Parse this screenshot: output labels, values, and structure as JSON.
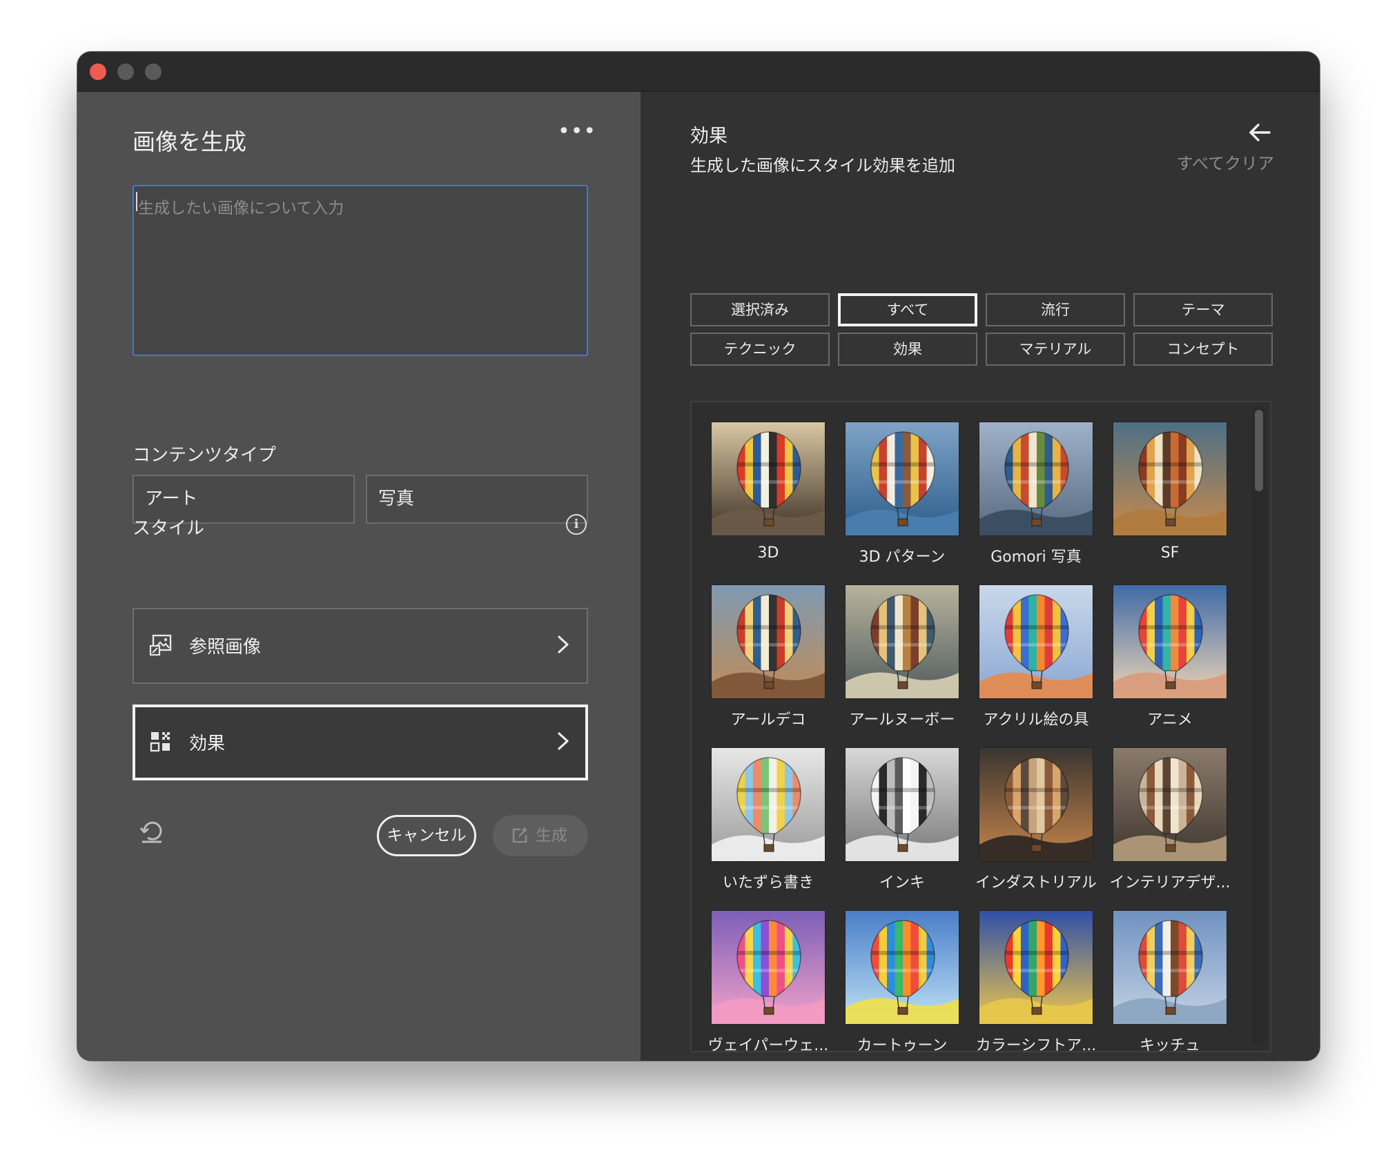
{
  "left": {
    "title": "画像を生成",
    "more_label": "•••",
    "prompt_placeholder": "生成したい画像について入力",
    "content_type_label": "コンテンツタイプ",
    "content_types": [
      "アート",
      "写真"
    ],
    "style_label": "スタイル",
    "info_label": "i",
    "reference_image_label": "参照画像",
    "effects_label": "効果",
    "cancel_label": "キャンセル",
    "generate_label": "生成"
  },
  "right": {
    "title": "効果",
    "subtitle": "生成した画像にスタイル効果を追加",
    "clear_all": "すべてクリア",
    "filters": [
      "選択済み",
      "すべて",
      "流行",
      "テーマ",
      "テクニック",
      "効果",
      "マテリアル",
      "コンセプト"
    ],
    "selected_filter": "すべて",
    "effects": [
      {
        "label": "3D"
      },
      {
        "label": "3D パターン"
      },
      {
        "label": "Gomori 写真"
      },
      {
        "label": "SF"
      },
      {
        "label": "アールデコ"
      },
      {
        "label": "アールヌーボー"
      },
      {
        "label": "アクリル絵の具"
      },
      {
        "label": "アニメ"
      },
      {
        "label": "いたずら書き"
      },
      {
        "label": "インキ"
      },
      {
        "label": "インダストリアル"
      },
      {
        "label": "インテリアデザ..."
      },
      {
        "label": "ヴェイパーウェ..."
      },
      {
        "label": "カートゥーン"
      },
      {
        "label": "カラーシフトア..."
      },
      {
        "label": "キッチュ"
      }
    ]
  },
  "colors": {
    "focus_blue": "#3b78e7",
    "close_red": "#ee5c50",
    "left_panel": "#505050",
    "right_panel": "#323232"
  }
}
